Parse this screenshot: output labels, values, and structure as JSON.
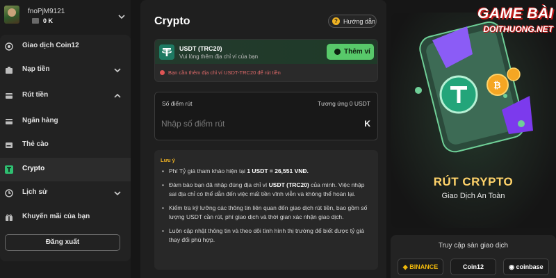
{
  "user": {
    "username": "fnoPjM9121",
    "balance": "0 K"
  },
  "sidebar": {
    "items": [
      {
        "label": "Giao dịch Coin12"
      },
      {
        "label": "Nạp tiền"
      },
      {
        "label": "Rút tiền"
      },
      {
        "label": "Ngân hàng"
      },
      {
        "label": "Thẻ cào"
      },
      {
        "label": "Crypto"
      },
      {
        "label": "Lịch sử"
      },
      {
        "label": "Khuyến mãi của bạn"
      }
    ],
    "logout_label": "Đăng xuất"
  },
  "main": {
    "title": "Crypto",
    "guide_label": "Hướng dẫn",
    "wallet": {
      "name": "USDT (TRC20)",
      "subtitle": "Vui lòng thêm địa chỉ ví của bạn",
      "add_button": "Thêm ví",
      "warning": "Bạn cần thêm địa chỉ ví USDT-TRC20 để rút tiền"
    },
    "amount": {
      "label": "Số điểm rút",
      "equivalent": "Tương ứng 0 USDT",
      "placeholder": "Nhập số điểm rút",
      "unit": "K"
    },
    "notes": {
      "title": "Lưu ý",
      "item1_prefix": "Phí Tỷ giá tham khảo hiện tại ",
      "item1_rate": "1 USDT = 26,551 VNĐ.",
      "item2_prefix": "Đảm bảo bạn đã nhập đúng địa chỉ ví ",
      "item2_bold": "USDT (TRC20)",
      "item2_suffix": " của mình. Việc nhập sai địa chỉ có thể dẫn đến việc mất tiền vĩnh viễn và không thể hoàn lại.",
      "item3": "Kiểm tra kỹ lưỡng các thông tin liên quan đến giao dịch rút tiền, bao gồm số lượng USDT cần rút, phí giao dịch và thời gian xác nhận giao dịch.",
      "item4": "Luôn cập nhật thông tin và theo dõi tình hình thị trường để biết được tỷ giá thay đổi phù hợp."
    }
  },
  "promo": {
    "title": "RÚT CRYPTO",
    "subtitle": "Giao Dịch An Toàn"
  },
  "exchange": {
    "title": "Truy cập sàn giao dịch",
    "buttons": [
      "BINANCE",
      "Coin12",
      "coinbase"
    ]
  },
  "watermark": {
    "line1": "GAME BÀI",
    "line2": "DOITHUONG.NET"
  },
  "colors": {
    "accent_green": "#58c96a",
    "gold": "#f0b323",
    "error_red": "#e05555"
  }
}
